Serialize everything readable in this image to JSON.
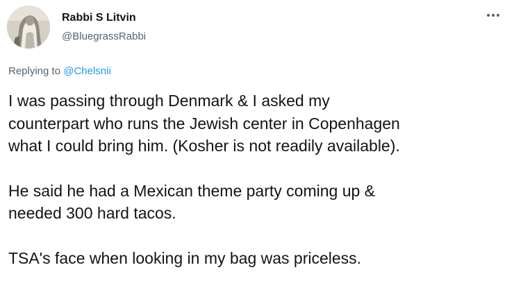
{
  "author": {
    "display_name": "Rabbi S Litvin",
    "handle": "@BluegrassRabbi",
    "avatar_icon": "profile-photo"
  },
  "more_icon": "more-horizontal-icon",
  "reply": {
    "prefix": "Replying to ",
    "mention": "@Chelsnii"
  },
  "tweet": {
    "paragraph_1": [
      "I was passing through Denmark & I asked my",
      "counterpart who runs the Jewish center in Copenhagen",
      "what I could bring him. (Kosher is not readily available)."
    ],
    "paragraph_2": [
      "He said he had a Mexican theme party coming up &",
      "needed 300 hard tacos."
    ],
    "paragraph_3": [
      "TSA's face when looking in my bag was priceless."
    ]
  },
  "colors": {
    "text": "#0f1419",
    "secondary": "#536471",
    "link": "#1d9bf0",
    "background": "#ffffff"
  }
}
